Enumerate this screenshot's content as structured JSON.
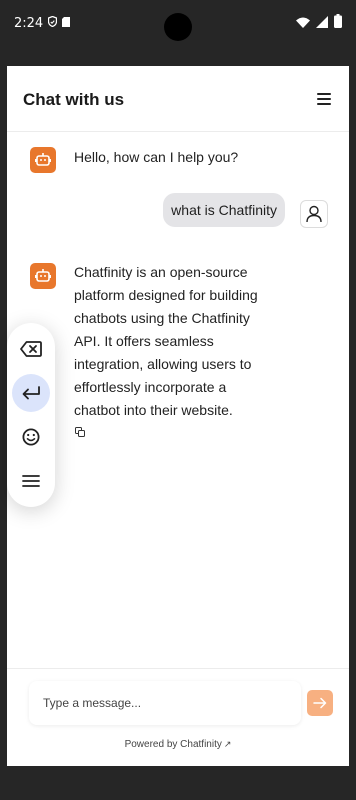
{
  "status_bar": {
    "time": "2:24",
    "icons": [
      "shield-icon",
      "sd-card-icon",
      "wifi-icon",
      "signal-icon",
      "battery-icon"
    ]
  },
  "header": {
    "title": "Chat with us",
    "menu_icon": "hamburger-menu-icon"
  },
  "messages": [
    {
      "role": "bot",
      "text": "Hello, how can I help you?",
      "avatar_icon": "robot-icon"
    },
    {
      "role": "user",
      "text": "what is Chatfinity",
      "avatar_icon": "user-icon"
    },
    {
      "role": "bot",
      "lines": [
        "Chatfinity is an open-source",
        "platform designed for building",
        "chatbots using the Chatfinity",
        "API. It offers seamless",
        "integration, allowing users to",
        "effortlessly incorporate a",
        "chatbot into their website."
      ],
      "avatar_icon": "robot-icon",
      "action_icon": "copy-icon"
    }
  ],
  "floating_keyboard": {
    "buttons": [
      "backspace-icon",
      "enter-icon",
      "emoji-icon",
      "menu-icon"
    ],
    "active_index": 1
  },
  "composer": {
    "placeholder": "Type a message...",
    "send_icon": "arrow-right-icon"
  },
  "footer": {
    "powered_by": "Powered by Chatfinity",
    "external_icon": "external-link-icon"
  },
  "colors": {
    "accent": "#e8772c",
    "send_button": "#f7b081",
    "user_bubble": "#e4e4e7",
    "active_key": "#dbe4fb"
  }
}
